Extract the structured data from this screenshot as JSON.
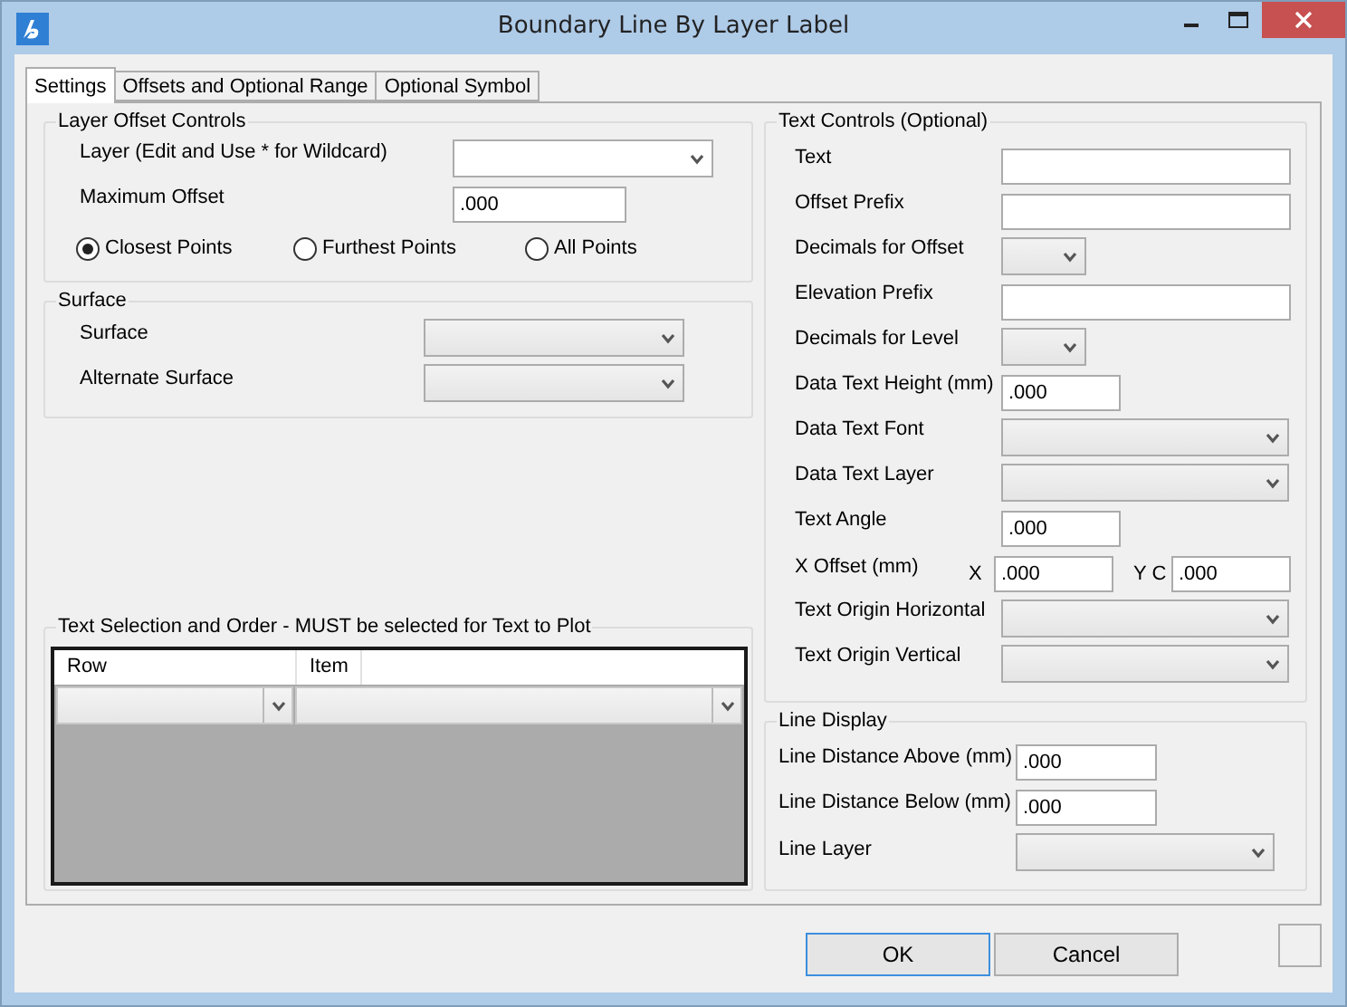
{
  "window": {
    "title": "Boundary Line By Layer Label"
  },
  "tabs": [
    {
      "label": "Settings",
      "selected": true
    },
    {
      "label": "Offsets and Optional Range",
      "selected": false
    },
    {
      "label": "Optional Symbol",
      "selected": false
    }
  ],
  "layer_offset_controls": {
    "title": "Layer  Offset Controls",
    "rows": [
      {
        "kind": "combo",
        "label": "Layer (Edit and Use * for Wildcard)",
        "editable": true
      },
      {
        "kind": "number",
        "label": "Maximum Offset",
        "value": ".000"
      }
    ],
    "point_options": [
      {
        "label": "Closest Points",
        "selected": true
      },
      {
        "label": "Furthest Points",
        "selected": false
      },
      {
        "label": "All Points",
        "selected": false
      }
    ]
  },
  "surface": {
    "title": "Surface",
    "rows": [
      {
        "kind": "combo",
        "label": "Surface",
        "editable": false
      },
      {
        "kind": "combo",
        "label": "Alternate Surface",
        "editable": false
      }
    ]
  },
  "text_selection": {
    "title": "Text Selection and Order - MUST be selected for Text to Plot",
    "columns": [
      "Row",
      "Item"
    ]
  },
  "text_controls": {
    "title": "Text Controls (Optional)",
    "rows": [
      {
        "kind": "text",
        "label": "Text",
        "value": ""
      },
      {
        "kind": "text",
        "label": "Offset Prefix",
        "value": ""
      },
      {
        "kind": "short_combo",
        "label": "Decimals for Offset",
        "editable": false
      },
      {
        "kind": "text",
        "label": "Elevation Prefix",
        "value": ""
      },
      {
        "kind": "short_combo",
        "label": "Decimals for Level",
        "editable": false
      },
      {
        "kind": "number",
        "label": "Data Text Height (mm)",
        "value": ".000"
      },
      {
        "kind": "combo",
        "label": "Data Text Font",
        "editable": false
      },
      {
        "kind": "combo",
        "label": "Data Text Layer",
        "editable": false
      },
      {
        "kind": "number",
        "label": "Text Angle",
        "value": ".000"
      },
      {
        "kind": "xy",
        "label": "X Offset (mm)",
        "x_label": "X",
        "x_value": ".000",
        "y_label": "Y C",
        "y_value": ".000"
      },
      {
        "kind": "combo",
        "label": "Text Origin Horizontal",
        "editable": false
      },
      {
        "kind": "combo",
        "label": "Text Origin Vertical",
        "editable": false
      }
    ]
  },
  "line_display": {
    "title": "Line Display",
    "rows": [
      {
        "kind": "number",
        "label": "Line Distance Above (mm)",
        "value": ".000"
      },
      {
        "kind": "number",
        "label": "Line Distance Below (mm)",
        "value": ".000"
      },
      {
        "kind": "combo",
        "label": "Line Layer",
        "editable": false
      }
    ]
  },
  "buttons": [
    {
      "label": "OK",
      "focused": true
    },
    {
      "label": "Cancel",
      "focused": false
    }
  ]
}
